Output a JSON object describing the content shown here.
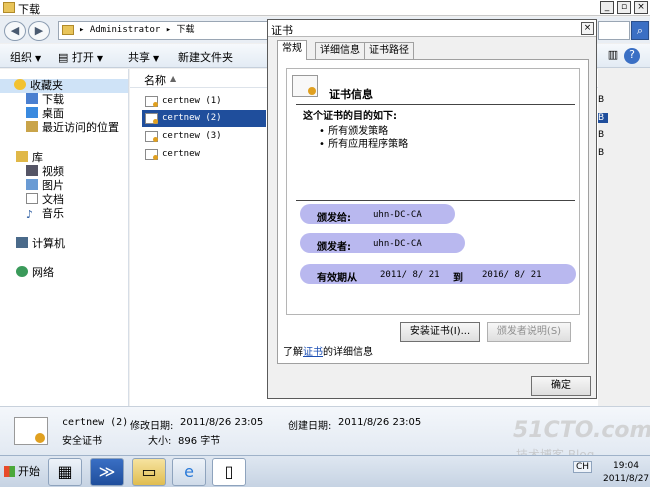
{
  "explorer": {
    "window_title": "下载",
    "address_path": "▸ Administrator ▸ 下载",
    "toolbar": {
      "organize": "组织",
      "open": "打开",
      "share": "共享",
      "new_folder": "新建文件夹"
    },
    "nav": {
      "favorites": "收藏夹",
      "downloads": "下载",
      "desktop": "桌面",
      "recent": "最近访问的位置",
      "libraries": "库",
      "videos": "视频",
      "pictures": "图片",
      "documents": "文档",
      "music": "音乐",
      "computer": "计算机",
      "network": "网络"
    },
    "column_name": "名称",
    "files": [
      {
        "name": "certnew (1)",
        "size_suffix": "B"
      },
      {
        "name": "certnew (2)",
        "size_suffix": "B"
      },
      {
        "name": "certnew (3)",
        "size_suffix": "B"
      },
      {
        "name": "certnew",
        "size_suffix": "B"
      }
    ],
    "details": {
      "file_name": "certnew (2)",
      "modified_label": "修改日期:",
      "modified_value": "2011/8/26 23:05",
      "created_label": "创建日期:",
      "created_value": "2011/8/26 23:05",
      "file_type": "安全证书",
      "size_label": "大小:",
      "size_value": "896 字节"
    }
  },
  "dialog": {
    "title": "证书",
    "tabs": [
      "常规",
      "详细信息",
      "证书路径"
    ],
    "cert_info_title": "证书信息",
    "purpose_title": "这个证书的目的如下:",
    "purposes": [
      "• 所有颁发策略",
      "• 所有应用程序策略"
    ],
    "issued_to_label": "颁发给:",
    "issued_to_value": "uhn-DC-CA",
    "issued_by_label": "颁发者:",
    "issued_by_value": "uhn-DC-CA",
    "validity_label": "有效期从",
    "valid_from": "2011/ 8/ 21",
    "to_label": "到",
    "valid_to": "2016/ 8/ 21",
    "install_button": "安装证书(I)...",
    "issuer_statement_button": "颁发者说明(S)",
    "learn_more_prefix": "了解",
    "learn_more_link": "证书",
    "learn_more_suffix": "的详细信息",
    "ok_button": "确定"
  },
  "taskbar": {
    "start": "开始",
    "lang": "CH",
    "time": "19:04",
    "date": "2011/8/27"
  },
  "watermark": {
    "line1": "51CTO.com",
    "line2": "技术博客 Blog"
  }
}
